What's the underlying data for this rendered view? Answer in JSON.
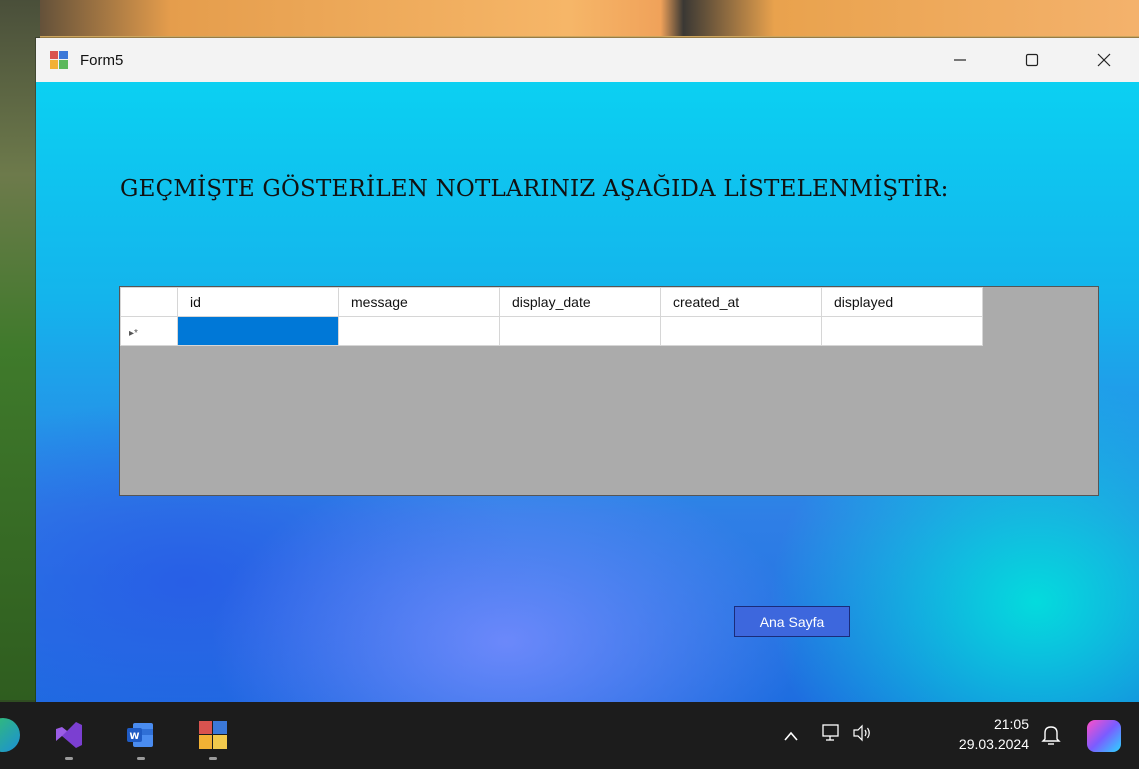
{
  "window": {
    "title": "Form5",
    "minimize_glyph": "—",
    "maximize_glyph": "☐",
    "close_glyph": "✕"
  },
  "form": {
    "heading": "GEÇMİŞTE GÖSTERİLEN NOTLARINIZ AŞAĞIDA LİSTELENMİŞTİR:",
    "home_button_label": "Ana Sayfa"
  },
  "grid": {
    "columns": [
      "id",
      "message",
      "display_date",
      "created_at",
      "displayed"
    ],
    "new_row_indicator": "▸*",
    "selection_color": "#0078d7",
    "background_color": "#ababab"
  },
  "taskbar": {
    "apps": [
      "edge-icon",
      "visual-studio-icon",
      "word-icon",
      "winforms-app-icon"
    ],
    "tray_chevron": "^",
    "time": "21:05",
    "date": "29.03.2024"
  },
  "colors": {
    "button_bg": "#3d67dd",
    "client_gradient_top": "#0bd0f2",
    "client_gradient_bottom": "#1e6de0"
  }
}
